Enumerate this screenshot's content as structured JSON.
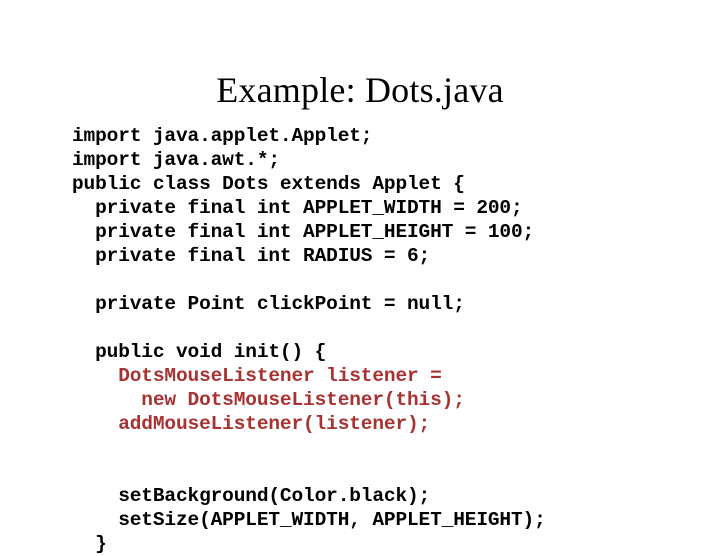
{
  "slide": {
    "title": "Example: Dots.java",
    "background_color": "#ffffff",
    "code_color_default": "#000000",
    "code_color_highlight": "#a83232",
    "code_lines": [
      {
        "text": "import java.applet.Applet;",
        "color": "black"
      },
      {
        "text": "import java.awt.*;",
        "color": "black"
      },
      {
        "text": "public class Dots extends Applet {",
        "color": "black"
      },
      {
        "text": "  private final int APPLET_WIDTH = 200;",
        "color": "black"
      },
      {
        "text": "  private final int APPLET_HEIGHT = 100;",
        "color": "black"
      },
      {
        "text": "  private final int RADIUS = 6;",
        "color": "black"
      },
      {
        "text": "",
        "color": "black"
      },
      {
        "text": "  private Point clickPoint = null;",
        "color": "black"
      },
      {
        "text": "",
        "color": "black"
      },
      {
        "text": "  public void init() {",
        "color": "black"
      },
      {
        "text": "    DotsMouseListener listener =",
        "color": "red"
      },
      {
        "text": "      new DotsMouseListener(this);",
        "color": "red"
      },
      {
        "text": "    addMouseListener(listener);",
        "color": "red"
      },
      {
        "text": "",
        "color": "black"
      },
      {
        "text": "",
        "color": "black"
      },
      {
        "text": "    setBackground(Color.black);",
        "color": "black"
      },
      {
        "text": "    setSize(APPLET_WIDTH, APPLET_HEIGHT);",
        "color": "black"
      },
      {
        "text": "  }",
        "color": "black"
      }
    ]
  }
}
